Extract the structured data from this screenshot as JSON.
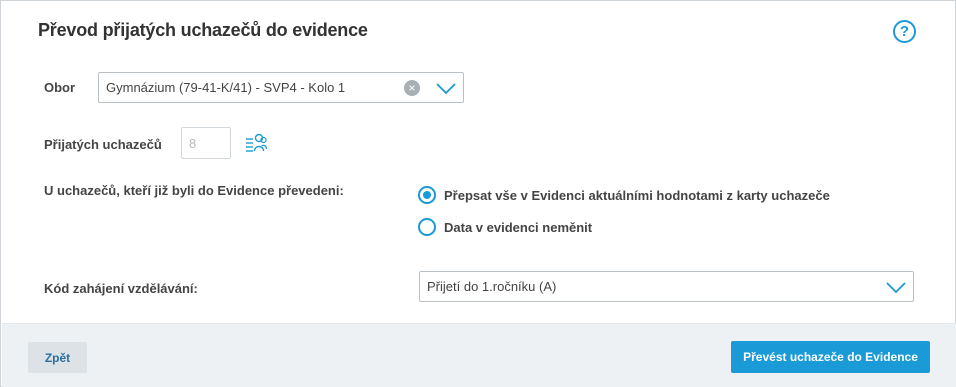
{
  "dialog": {
    "title": "Převod přijatých uchazečů do evidence",
    "help_label": "?"
  },
  "form": {
    "obor": {
      "label": "Obor",
      "value": "Gymnázium (79-41-K/41)  - SVP4 - Kolo 1",
      "clear_glyph": "×"
    },
    "prijatych": {
      "label": "Přijatých uchazečů",
      "value": "8"
    },
    "already_transferred": {
      "label": "U uchazečů, kteří již byli do Evidence převedeni:",
      "options": [
        {
          "label": "Přepsat vše v Evidenci aktuálními hodnotami z karty uchazeče",
          "selected": true
        },
        {
          "label": "Data v evidenci neměnit",
          "selected": false
        }
      ]
    },
    "kod": {
      "label": "Kód zahájení vzdělávání:",
      "value": "Přijetí do 1.ročníku (A)"
    }
  },
  "footer": {
    "back_label": "Zpět",
    "submit_label": "Převést uchazeče do Evidence"
  },
  "colors": {
    "accent": "#1a9bd7",
    "footer_bg": "#eef1f4"
  },
  "icons": {
    "help": "question-circle-icon",
    "clear": "clear-icon",
    "dropdown": "chevron-down-icon",
    "people_list": "people-list-icon"
  }
}
